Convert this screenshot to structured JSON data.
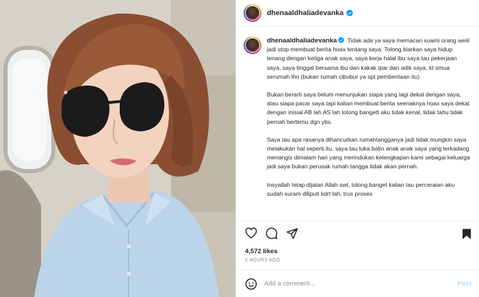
{
  "post": {
    "username": "dhenaaldhaliadevanka",
    "caption": {
      "username": "dhenaaldhaliadevanka",
      "paragraphs": [
        "Tidak ada ya saya memacari suami orang weiii jadi stop membuat berita hoax tentang saya. Tolong biarkan saya hidup tenang dengan ketiga anak saya, saya kerja halal ibu saya tau pekerjaan saya, saya tinggal bersama ibu dan kakak ipar dan adik saya, kt smua serumah lho (bukan rumah cibubur ya spt pemberitaan itu)",
        "Bukan berarti saya belum menunjukan siapa yang lagi dekat dengan saya, atau siapa pacar saya tapi kalian membuat berita seenaknya hoax saya dekat dengan inisial AB lah AS lah tolong bangett aku tidak kenal, tidak tahu tidak pernah bertemu dgn ybs.",
        "Saya tau apa rasanya dihancurkan rumahtangganya jadi tidak mungkin saya melakukan hal seperti itu, saya tau luka batin anak anak saya yang terkadang menangis dimalam hari yang merindukan kelengkapan kami sebagai keluarga jadi saya bukan perusak rumah tangga tidak akan pernah.",
        "Insyallah tetap dijalan Allah swt, tolong banget kalian tau perceraian aku sudah suram diliputi kdrt lah, trus proses"
      ]
    },
    "likes": "4,572 likes",
    "time": "6 HOURS AGO",
    "comment_placeholder": "Add a comment...",
    "post_label": "Post"
  },
  "icons": {
    "verified": "verified-badge-icon",
    "like": "heart-icon",
    "comment": "comment-icon",
    "share": "paper-plane-icon",
    "save": "bookmark-icon",
    "emoji": "smiley-icon"
  },
  "colors": {
    "verified_blue": "#0095f6",
    "post_button": "#b2dffc",
    "secondary_text": "#8e8e8e",
    "primary_text": "#262626"
  }
}
